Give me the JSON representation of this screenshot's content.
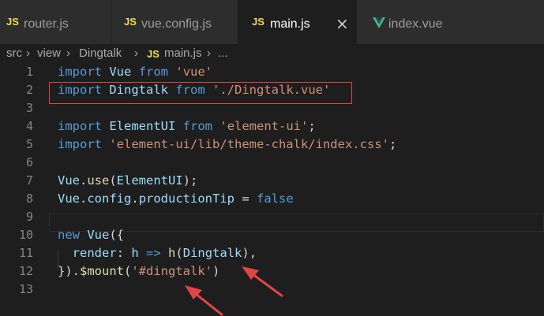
{
  "tabs": [
    {
      "icon": "JS",
      "label": "router.js"
    },
    {
      "icon": "JS",
      "label": "vue.config.js"
    },
    {
      "icon": "JS",
      "label": "main.js",
      "close": "×"
    },
    {
      "icon": "vue-icon",
      "label": "index.vue"
    }
  ],
  "breadcrumb": {
    "p1": "src",
    "p2": "view",
    "p3": "Dingtalk",
    "icon": "JS",
    "p4": "main.js",
    "p5": "..."
  },
  "line_numbers": [
    "1",
    "2",
    "3",
    "4",
    "5",
    "6",
    "7",
    "8",
    "9",
    "10",
    "11",
    "12",
    "13"
  ],
  "code": {
    "l1": {
      "kw": "import",
      "id": "Vue",
      "kw2": "from",
      "str": "'vue'"
    },
    "l2": {
      "kw": "import",
      "id": "Dingtalk",
      "kw2": "from",
      "str": "'./Dingtalk.vue'"
    },
    "l4": {
      "kw": "import",
      "id": "ElementUI",
      "kw2": "from",
      "str": "'element-ui'",
      "end": ";"
    },
    "l5": {
      "kw": "import",
      "str": "'element-ui/lib/theme-chalk/index.css'",
      "end": ";"
    },
    "l7": {
      "id": "Vue",
      "fn": "use",
      "arg": "ElementUI",
      "end": ");"
    },
    "l8": {
      "id": "Vue",
      "p1": "config",
      "p2": "productionTip",
      "op": " = ",
      "val": "false"
    },
    "l10": {
      "kw": "new",
      "id": "Vue",
      "end": "({"
    },
    "l11": {
      "prop": "render",
      "arg": "h",
      "arrow": "=>",
      "fn": "h",
      "inner": "Dingtalk",
      "end": "),"
    },
    "l12": {
      "start": "}).",
      "fn": "$mount",
      "str": "'#dingtalk'",
      "end": ")"
    }
  },
  "colors": {
    "keyword": "#569cd6",
    "identifier": "#9cdcfe",
    "string": "#ce9178",
    "function": "#dcdcaa",
    "annotation": "#e04545"
  }
}
